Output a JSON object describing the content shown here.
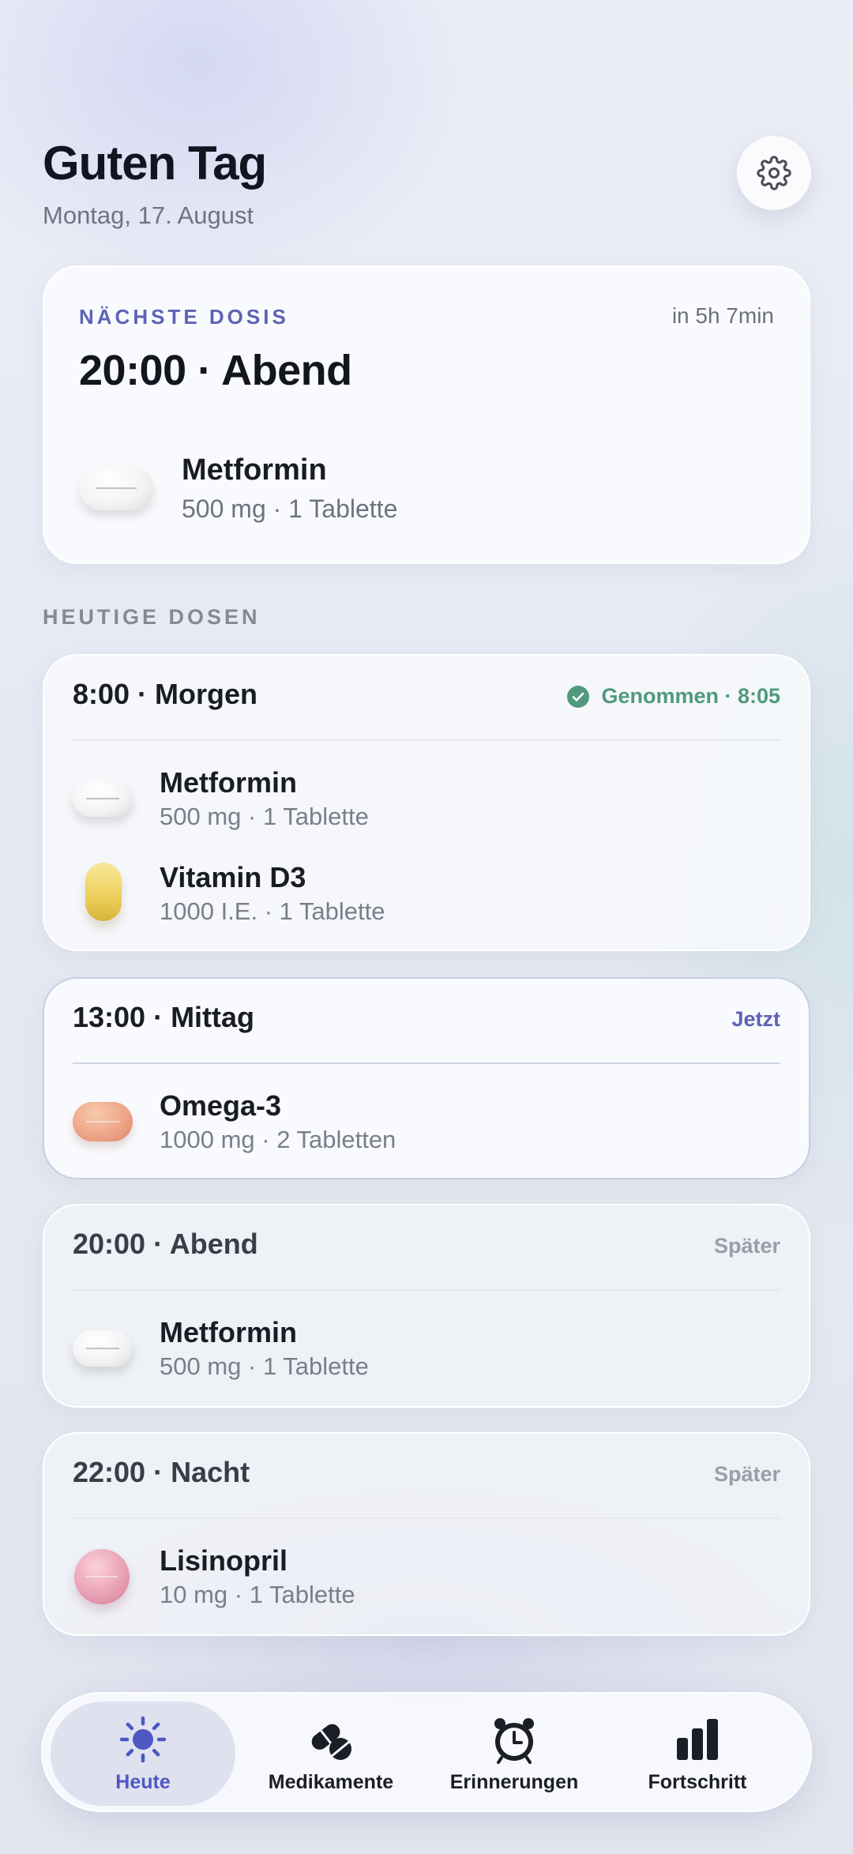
{
  "header": {
    "greeting": "Guten Tag",
    "date": "Montag, 17. August"
  },
  "next_dose": {
    "label": "NÄCHSTE DOSIS",
    "eta": "in 5h 7min",
    "time": "20:00 · Abend",
    "medication": {
      "name": "Metformin",
      "dose": "500 mg · 1 Tablette",
      "pill": "white-oval-pill"
    }
  },
  "section_label": "HEUTIGE DOSEN",
  "doses": [
    {
      "time": "8:00 · Morgen",
      "status": "Genommen · 8:05",
      "status_type": "taken",
      "medications": [
        {
          "name": "Metformin",
          "dose": "500 mg · 1 Tablette",
          "pill": "white-oval-pill"
        },
        {
          "name": "Vitamin D3",
          "dose": "1000 I.E. · 1 Tablette",
          "pill": "yellow-capsule"
        }
      ]
    },
    {
      "time": "13:00 · Mittag",
      "status": "Jetzt",
      "status_type": "now",
      "medications": [
        {
          "name": "Omega-3",
          "dose": "1000 mg · 2 Tabletten",
          "pill": "orange-oval-pill"
        }
      ]
    },
    {
      "time": "20:00 · Abend",
      "status": "Später",
      "status_type": "later",
      "medications": [
        {
          "name": "Metformin",
          "dose": "500 mg · 1 Tablette",
          "pill": "white-oval-pill"
        }
      ]
    },
    {
      "time": "22:00 · Nacht",
      "status": "Später",
      "status_type": "later",
      "medications": [
        {
          "name": "Lisinopril",
          "dose": "10 mg · 1 Tablette",
          "pill": "pink-round-pill"
        }
      ]
    }
  ],
  "nav": [
    {
      "label": "Heute",
      "icon": "sun-icon",
      "active": true
    },
    {
      "label": "Medikamente",
      "icon": "pills-icon",
      "active": false
    },
    {
      "label": "Erinnerungen",
      "icon": "alarm-clock-icon",
      "active": false
    },
    {
      "label": "Fortschritt",
      "icon": "bar-chart-icon",
      "active": false
    }
  ],
  "colors": {
    "accent": "#5c63b5",
    "taken": "#4f9a7d",
    "later": "#9a9ea8"
  }
}
